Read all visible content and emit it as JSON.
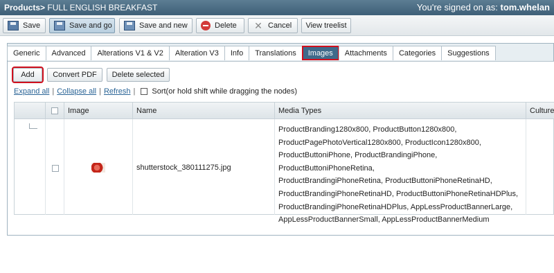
{
  "titlebar": {
    "section": "Products>",
    "item": "FULL ENGLISH BREAKFAST",
    "signed_prefix": "You're signed on as:",
    "user": "tom.whelan"
  },
  "toolbar": {
    "save": "Save",
    "save_and_go": "Save and go",
    "save_and_new": "Save and new",
    "delete": "Delete",
    "cancel": "Cancel",
    "view_treelist": "View treelist"
  },
  "tabs": [
    "Generic",
    "Advanced",
    "Alterations V1 & V2",
    "Alteration V3",
    "Info",
    "Translations",
    "Images",
    "Attachments",
    "Categories",
    "Suggestions"
  ],
  "selected_tab": "Images",
  "actions": {
    "add": "Add",
    "convert_pdf": "Convert PDF",
    "delete_selected": "Delete selected"
  },
  "links": {
    "expand_all": "Expand all",
    "collapse_all": "Collapse all",
    "refresh": "Refresh",
    "sort_label": "Sort(or hold shift while dragging the nodes)"
  },
  "grid": {
    "columns": {
      "image": "Image",
      "name": "Name",
      "media_types": "Media Types",
      "cultures": "Cultures"
    },
    "rows": [
      {
        "name": "shutterstock_380111275.jpg",
        "media_lines": [
          "ProductBranding1280x800, ProductButton1280x800,",
          "ProductPagePhotoVertical1280x800, ProductIcon1280x800,",
          "ProductButtoniPhone, ProductBrandingiPhone, ProductButtoniPhoneRetina,",
          "ProductBrandingiPhoneRetina, ProductButtoniPhoneRetinaHD,",
          "ProductBrandingiPhoneRetinaHD, ProductButtoniPhoneRetinaHDPlus,",
          "ProductBrandingiPhoneRetinaHDPlus, AppLessProductBannerLarge,",
          "AppLessProductBannerSmall, AppLessProductBannerMedium"
        ]
      }
    ]
  },
  "colors": {
    "titlebar": "#4a6b82",
    "selected_tab": "#3f6a8a",
    "highlight": "#d0101e",
    "link": "#2a6496"
  }
}
